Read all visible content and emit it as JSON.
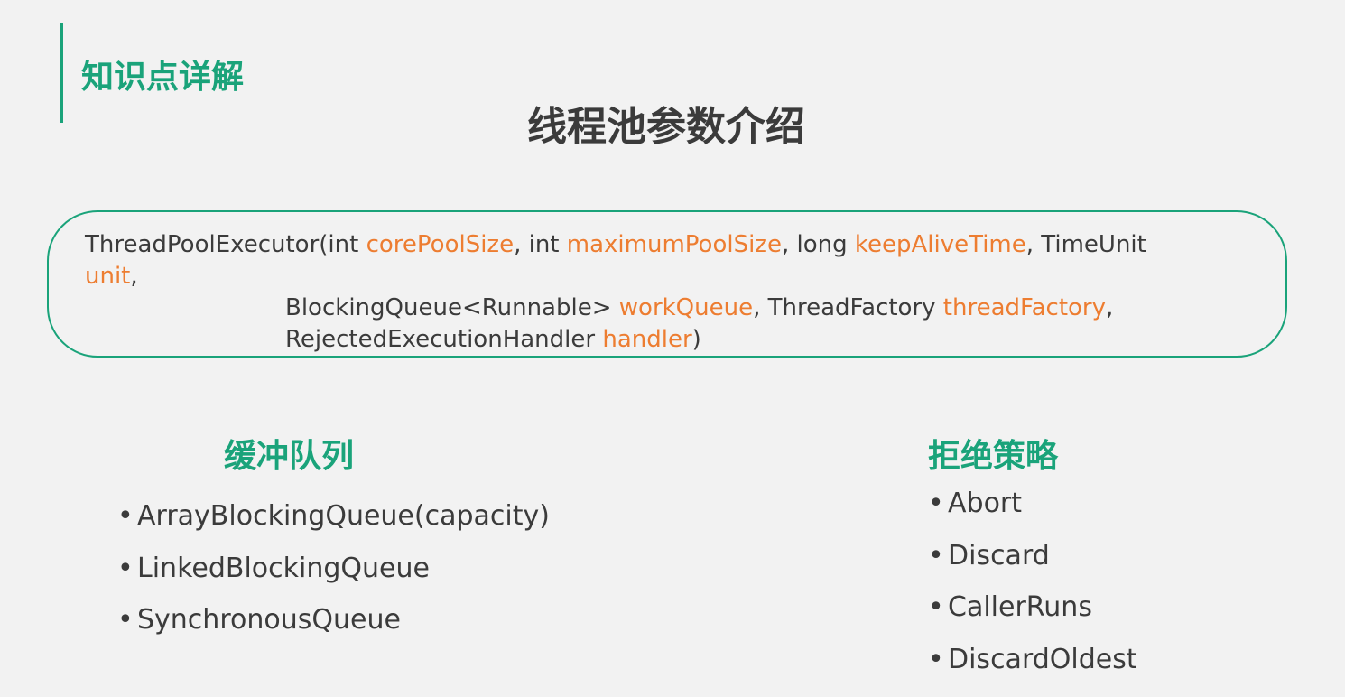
{
  "header": {
    "section_label": "知识点详解",
    "title": "线程池参数介绍"
  },
  "signature": {
    "line1": {
      "t1": "ThreadPoolExecutor(int ",
      "p1": "corePoolSize",
      "t2": ", int ",
      "p2": "maximumPoolSize",
      "t3": ", long ",
      "p3": "keepAliveTime",
      "t4": ", TimeUnit"
    },
    "line2": {
      "p1": "unit",
      "t1": ","
    },
    "line3": {
      "t1": "BlockingQueue<Runnable> ",
      "p1": "workQueue",
      "t2": ", ThreadFactory ",
      "p2": "threadFactory",
      "t3": ","
    },
    "line4": {
      "t1": "RejectedExecutionHandler ",
      "p1": "handler",
      "t2": ")"
    }
  },
  "queues": {
    "heading": "缓冲队列",
    "items": [
      "ArrayBlockingQueue(capacity)",
      "LinkedBlockingQueue",
      "SynchronousQueue"
    ]
  },
  "reject_policies": {
    "heading": "拒绝策略",
    "items": [
      "Abort",
      "Discard",
      "CallerRuns",
      "DiscardOldest"
    ]
  },
  "bullet_char": "•",
  "colors": {
    "accent": "#1aa37a",
    "param": "#ed7d31",
    "text": "#3b3b3b",
    "background": "#f2f2f2"
  }
}
